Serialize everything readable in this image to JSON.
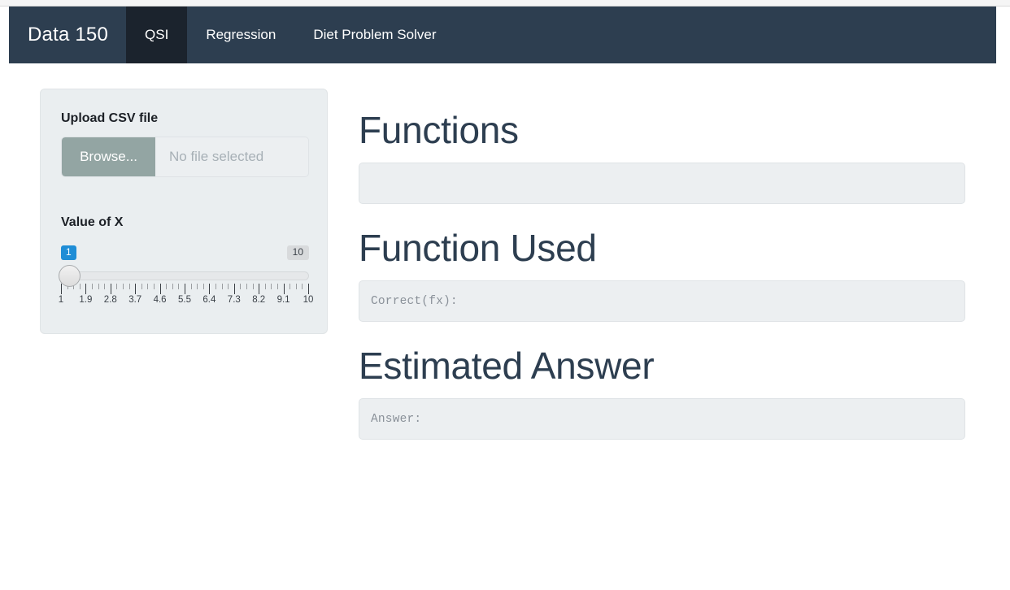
{
  "navbar": {
    "brand": "Data 150",
    "items": [
      {
        "label": "QSI",
        "active": true
      },
      {
        "label": "Regression",
        "active": false
      },
      {
        "label": "Diet Problem Solver",
        "active": false
      }
    ],
    "background_color": "#2d3e50",
    "active_background_color": "#1b232d"
  },
  "sidebar": {
    "upload": {
      "label": "Upload CSV file",
      "browse_label": "Browse...",
      "file_placeholder": "No file selected",
      "browse_color": "#93a5a3"
    },
    "slider": {
      "label": "Value of X",
      "value": "1",
      "max_label": "10",
      "min": 1,
      "max": 10,
      "tick_labels": [
        "1",
        "1.9",
        "2.8",
        "3.7",
        "4.6",
        "5.5",
        "6.4",
        "7.3",
        "8.2",
        "9.1",
        "10"
      ],
      "handle_color": "#dcdcdc",
      "tooltip_color": "#1f8dd6"
    },
    "panel_color": "#eaeef0"
  },
  "main": {
    "sections": [
      {
        "title": "Functions",
        "value": ""
      },
      {
        "title": "Function Used",
        "value": "Correct(fx):"
      },
      {
        "title": "Estimated Answer",
        "value": "Answer:"
      }
    ],
    "heading_color": "#2d3e50",
    "output_background": "#eceff1"
  }
}
